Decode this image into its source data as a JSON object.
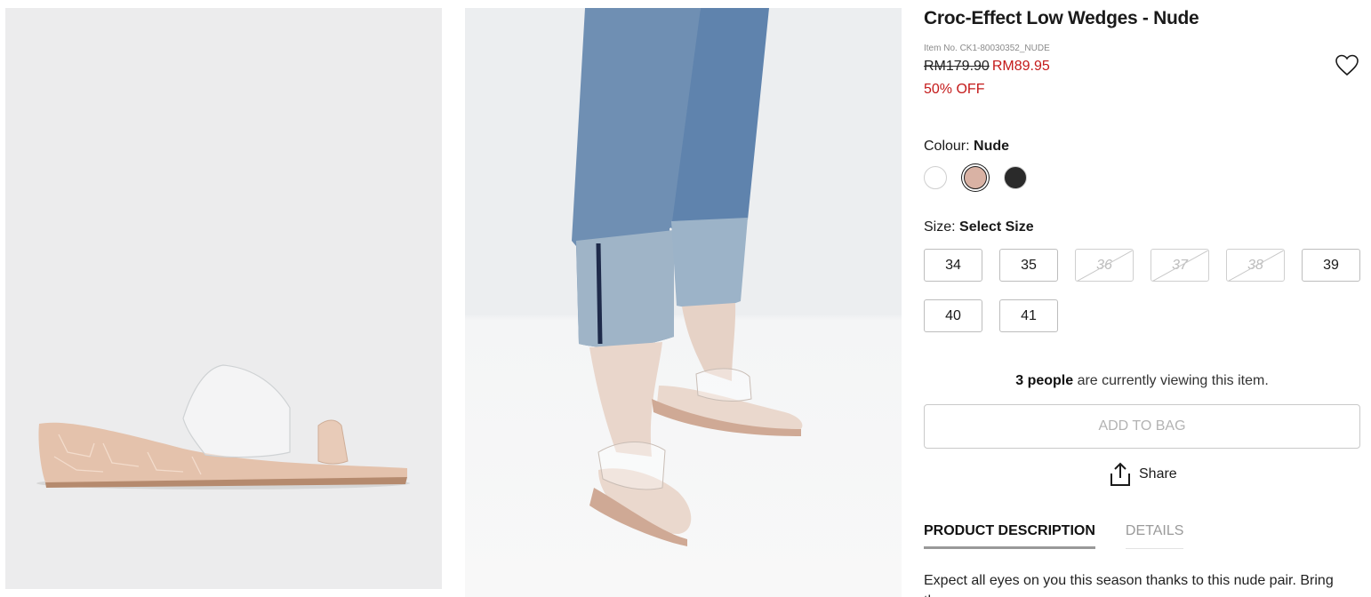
{
  "product": {
    "title": "Croc-Effect Low Wedges - Nude",
    "item_no": "Item No. CK1-80030352_NUDE",
    "price_original": "RM179.90",
    "price_sale": "RM89.95",
    "discount": "50% OFF"
  },
  "colour": {
    "label": "Colour:",
    "selected": "Nude",
    "options": [
      {
        "name": "White",
        "hex": "#ffffff"
      },
      {
        "name": "Nude",
        "hex": "#d9b2a4"
      },
      {
        "name": "Black",
        "hex": "#2a2a2a"
      }
    ]
  },
  "size": {
    "label": "Size:",
    "selected": "Select Size",
    "options": [
      {
        "value": "34",
        "available": true
      },
      {
        "value": "35",
        "available": true
      },
      {
        "value": "36",
        "available": false
      },
      {
        "value": "37",
        "available": false
      },
      {
        "value": "38",
        "available": false
      },
      {
        "value": "39",
        "available": true
      },
      {
        "value": "40",
        "available": true
      },
      {
        "value": "41",
        "available": true
      }
    ]
  },
  "viewing": {
    "count": "3 people",
    "text": " are currently viewing this item."
  },
  "actions": {
    "add_to_bag": "ADD TO BAG",
    "share": "Share"
  },
  "tabs": [
    {
      "label": "PRODUCT DESCRIPTION",
      "active": true
    },
    {
      "label": "DETAILS",
      "active": false
    }
  ],
  "description": "Expect all eyes on you this season thanks to this nude pair. Bring these",
  "colors": {
    "sale": "#c41a1a",
    "jeans": "#5a7fa8",
    "nude": "#d9b2a4"
  }
}
